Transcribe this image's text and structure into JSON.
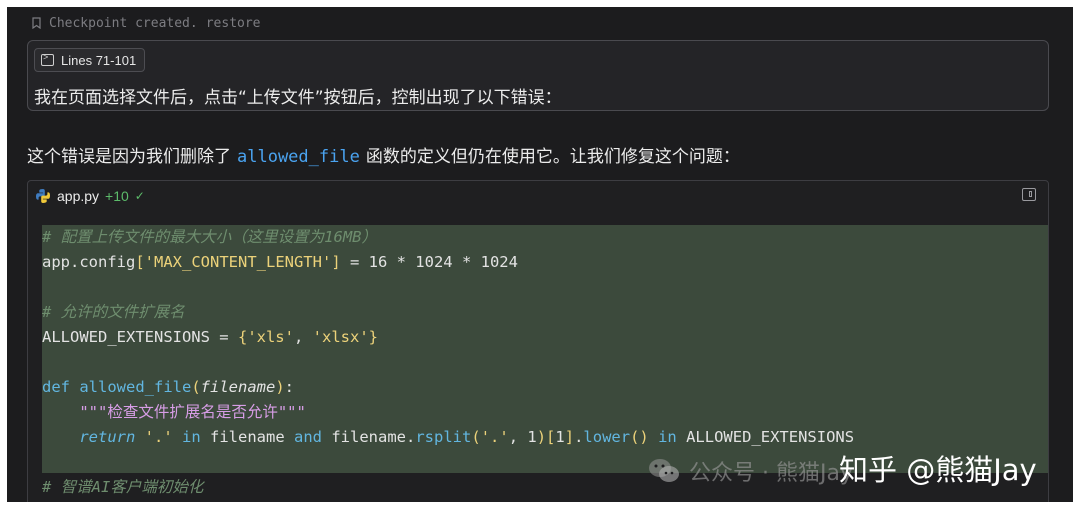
{
  "checkpoint": {
    "text": "Checkpoint created.",
    "restore": "restore"
  },
  "user_message": {
    "chip_label": "Lines 71-101",
    "text": "我在页面选择文件后，点击“上传文件”按钮后，控制出现了以下错误："
  },
  "assistant": {
    "before": "这个错误是因为我们删除了",
    "code_ref": "allowed_file",
    "after": "函数的定义但仍在使用它。让我们修复这个问题："
  },
  "code_block": {
    "filename": "app.py",
    "diff_count": "+10",
    "lines": [
      "# 配置上传文件的最大大小（这里设置为16MB）",
      "app.config['MAX_CONTENT_LENGTH'] = 16 * 1024 * 1024",
      "",
      "# 允许的文件扩展名",
      "ALLOWED_EXTENSIONS = {'xls', 'xlsx'}",
      "",
      "def allowed_file(filename):",
      "    \"\"\"检查文件扩展名是否允许\"\"\"",
      "    return '.' in filename and filename.rsplit('.', 1)[1].lower() in ALLOWED_EXTENSIONS",
      "",
      "# 智谱AI客户端初始化"
    ]
  },
  "watermark": {
    "small": "公众号 · 熊猫Jay",
    "main": "知乎 @熊猫Jay"
  },
  "colors": {
    "background": "#1c1c1e",
    "added_line": "#3c4a3c",
    "link": "#4aa3f0",
    "diff_green": "#5cbb6a"
  }
}
